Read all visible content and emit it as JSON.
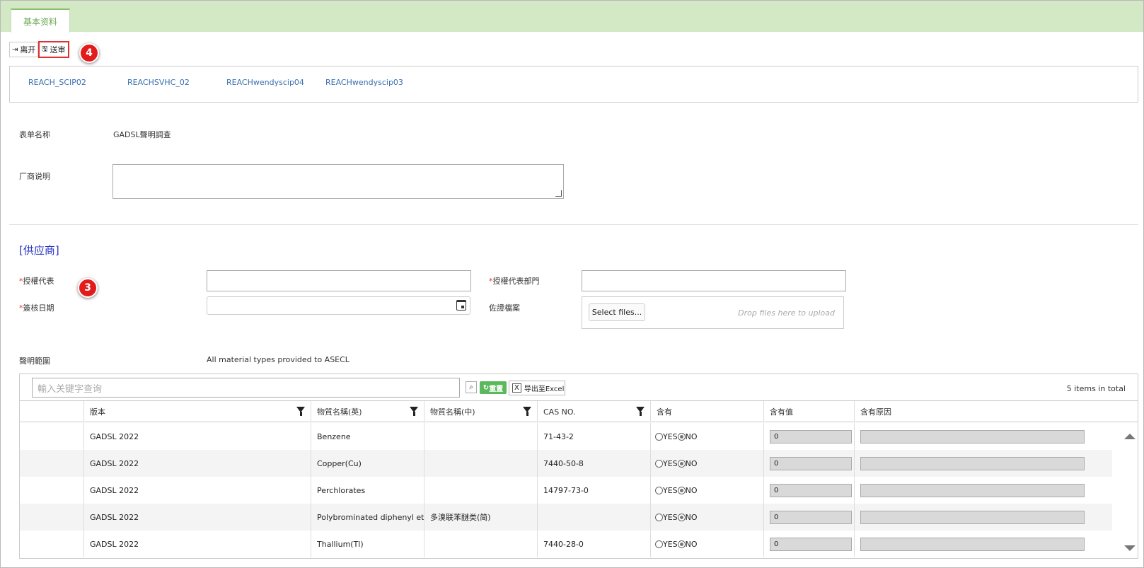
{
  "tab": {
    "label": "基本资料"
  },
  "toolbar": {
    "exit_label": "离开",
    "submit_label": "送审"
  },
  "markers": {
    "four": "4",
    "three": "3"
  },
  "links": [
    "REACH_SCIP02",
    "REACHSVHC_02",
    "REACHwendyscip04",
    "REACHwendyscip03"
  ],
  "form": {
    "form_name_label": "表单名称",
    "form_name_value": "GADSL聲明調查",
    "vendor_note_label": "厂商说明"
  },
  "supplier": {
    "section_title": "[供应商]",
    "required_mark": "*",
    "rep_label": "授權代表",
    "rep_dept_label": "授權代表部門",
    "sign_date_label": "簽核日期",
    "evidence_label": "佐證檔案",
    "select_files": "Select files...",
    "drop_hint": "Drop files here to upload",
    "scope_label": "聲明範圍",
    "scope_value": "All material types provided to ASECL"
  },
  "grid": {
    "search_placeholder": "輸入关键字查询",
    "reset_label": "重置",
    "export_label": "导出至Excel",
    "total": "5 items in total",
    "columns": [
      "版本",
      "物質名稱(英)",
      "物質名稱(中)",
      "CAS NO.",
      "含有",
      "含有值",
      "含有原因"
    ],
    "yes_label": "YES",
    "no_label": "NO",
    "rows": [
      {
        "version": "GADSL 2022",
        "name_en": "Benzene",
        "name_cn": "",
        "cas": "71-43-2",
        "value": "0"
      },
      {
        "version": "GADSL 2022",
        "name_en": "Copper(Cu)",
        "name_cn": "",
        "cas": "7440-50-8",
        "value": "0"
      },
      {
        "version": "GADSL 2022",
        "name_en": "Perchlorates",
        "name_cn": "",
        "cas": "14797-73-0",
        "value": "0"
      },
      {
        "version": "GADSL 2022",
        "name_en": "Polybrominated diphenyl ethers(",
        "name_cn": "多溴联苯醚类(简)",
        "cas": "",
        "value": "0"
      },
      {
        "version": "GADSL 2022",
        "name_en": "Thallium(Tl)",
        "name_cn": "",
        "cas": "7440-28-0",
        "value": "0"
      }
    ]
  }
}
